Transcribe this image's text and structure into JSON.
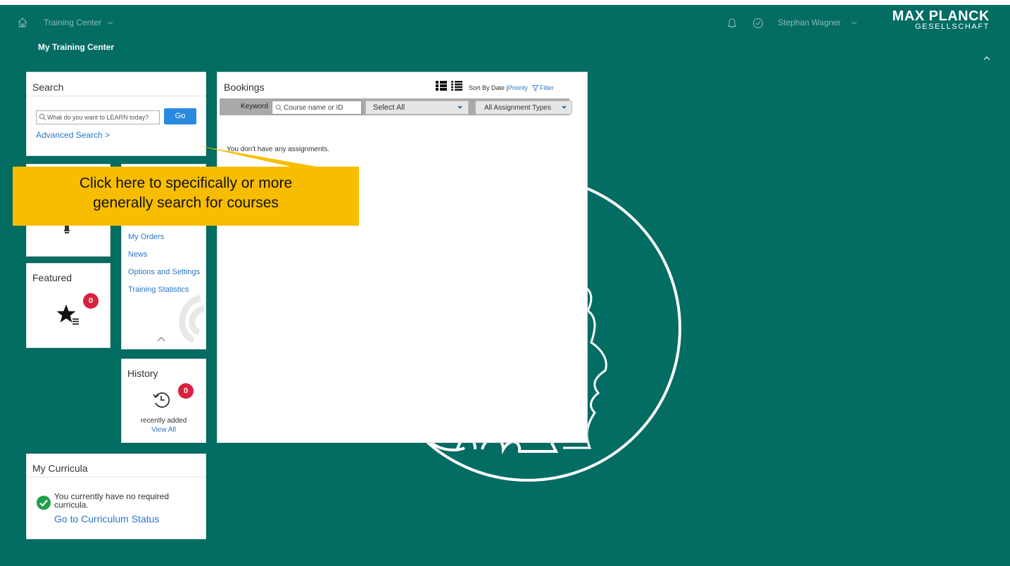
{
  "topbar": {
    "app_name": "Training Center",
    "user_name": "Stephan Wagner",
    "logo_main": "MAX PLANCK",
    "logo_sub": "GESELLSCHAFT"
  },
  "page_title": "My Training Center",
  "search": {
    "title": "Search",
    "placeholder": "What do you want to LEARN today?",
    "go_label": "Go",
    "advanced_label": "Advanced Search >"
  },
  "links": {
    "items": [
      "My Orders",
      "News",
      "Options and Settings",
      "Training Statistics"
    ]
  },
  "featured": {
    "title": "Featured",
    "count": "0"
  },
  "history": {
    "title": "History",
    "count": "0",
    "recent_label": "recently added",
    "view_all_label": "View All"
  },
  "curricula": {
    "title": "My Curricula",
    "message": "You currently have no required curricula.",
    "status_link": "Go to Curriculum Status"
  },
  "bookings": {
    "title": "Bookings",
    "sort_prefix": "Sort By Date | ",
    "sort_priority": "Priority",
    "filter_label": "Filter",
    "keyword_label": "Keyword",
    "keyword_placeholder": "Course name or ID",
    "select_all": "Select All",
    "assignment_types": "All Assignment Types",
    "empty_message": "You don't have any assignments."
  },
  "callout": {
    "line1": "Click here to specifically or more",
    "line2": "generally search for courses"
  },
  "colors": {
    "background": "#036c63",
    "callout": "#f8bd00",
    "link": "#2a77c5",
    "go_button": "#2a8ae0",
    "badge": "#d9203e",
    "success": "#1e9e4a"
  }
}
